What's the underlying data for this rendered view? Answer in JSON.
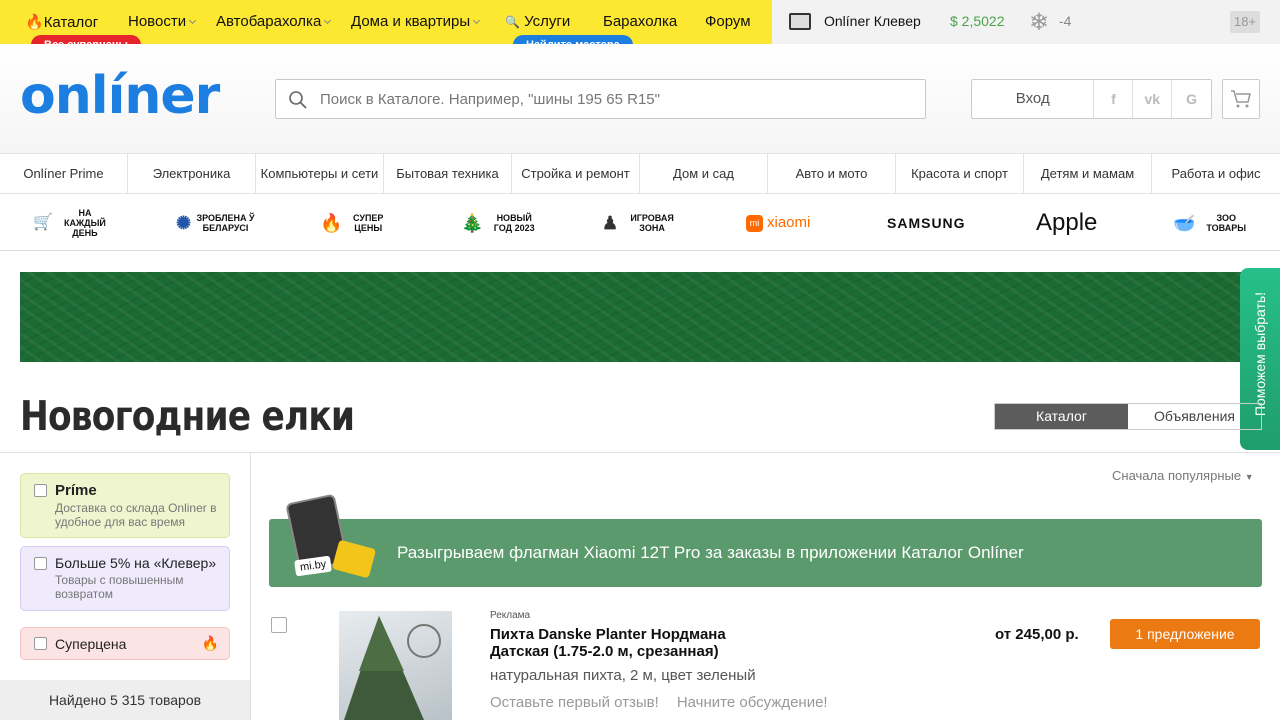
{
  "topnav": {
    "catalog": "Каталог",
    "news": "Новости",
    "auto": "Автобарахолка",
    "realty": "Дома и квартиры",
    "services": "Услуги",
    "baraholka": "Барахолка",
    "forum": "Форум",
    "catalog_badge": "Все суперцены",
    "services_badge": "Найдите мастера",
    "klever_label": "Onlíner Клевер",
    "currency_rate": "$ 2,5022",
    "weather_temp": "-4",
    "age_rating": "18+"
  },
  "header": {
    "logo_text": "onlíner",
    "search_placeholder": "Поиск в Каталоге. Например, \"шины 195 65 R15\"",
    "login_label": "Вход",
    "social_facebook": "f",
    "social_vk": "vk",
    "social_google": "G"
  },
  "categories": [
    "Onlíner Prime",
    "Электроника",
    "Компьютеры и сети",
    "Бытовая техника",
    "Стройка и ремонт",
    "Дом и сад",
    "Авто и мото",
    "Красота и спорт",
    "Детям и мамам",
    "Работа и офис"
  ],
  "promos": {
    "everyday": "На каждый день",
    "belarus": "Зроблена ў Беларусі",
    "super": "Супер цены",
    "newyear": "Новый год 2023",
    "gaming": "Игровая зона",
    "xiaomi": "xiaomi",
    "samsung": "SAMSUNG",
    "apple": "Apple",
    "zoo": "Зоо товары"
  },
  "side_help": "Поможем выбрать!",
  "page_title": "Новогодние елки",
  "tabs": {
    "catalog": "Каталог",
    "ads": "Объявления"
  },
  "filters": {
    "prime_title": "Príme",
    "prime_sub": "Доставка со склада Onliner в удобное для вас время",
    "klever_title": "Больше 5% на «Клевер»",
    "klever_sub": "Товары с повышенным возвратом",
    "supercena_title": "Суперцена"
  },
  "found_text": "Найдено 5 315 товаров",
  "sort_label": "Сначала популярные",
  "promo_band": {
    "text": "Разыгрываем флагман Xiaomi 12T Pro за заказы в приложении Каталог Onlíner",
    "tag": "mi.by"
  },
  "product": {
    "ad_label": "Реклама",
    "title": "Пихта Danske Planter Нордмана Датская (1.75-2.0 м, срезанная)",
    "description": "натуральная пихта, 2 м, цвет зеленый",
    "review_link": "Оставьте первый отзыв!",
    "discuss_link": "Начните обсуждение!",
    "price": "от 245,00 р.",
    "offer_button": "1 предложение"
  },
  "colors": {
    "topbar_yellow": "#fde831",
    "brand_blue": "#1c7ee0",
    "badge_red": "#e5252a",
    "offer_orange": "#ec7a13",
    "promo_green": "#5a9a6c"
  }
}
